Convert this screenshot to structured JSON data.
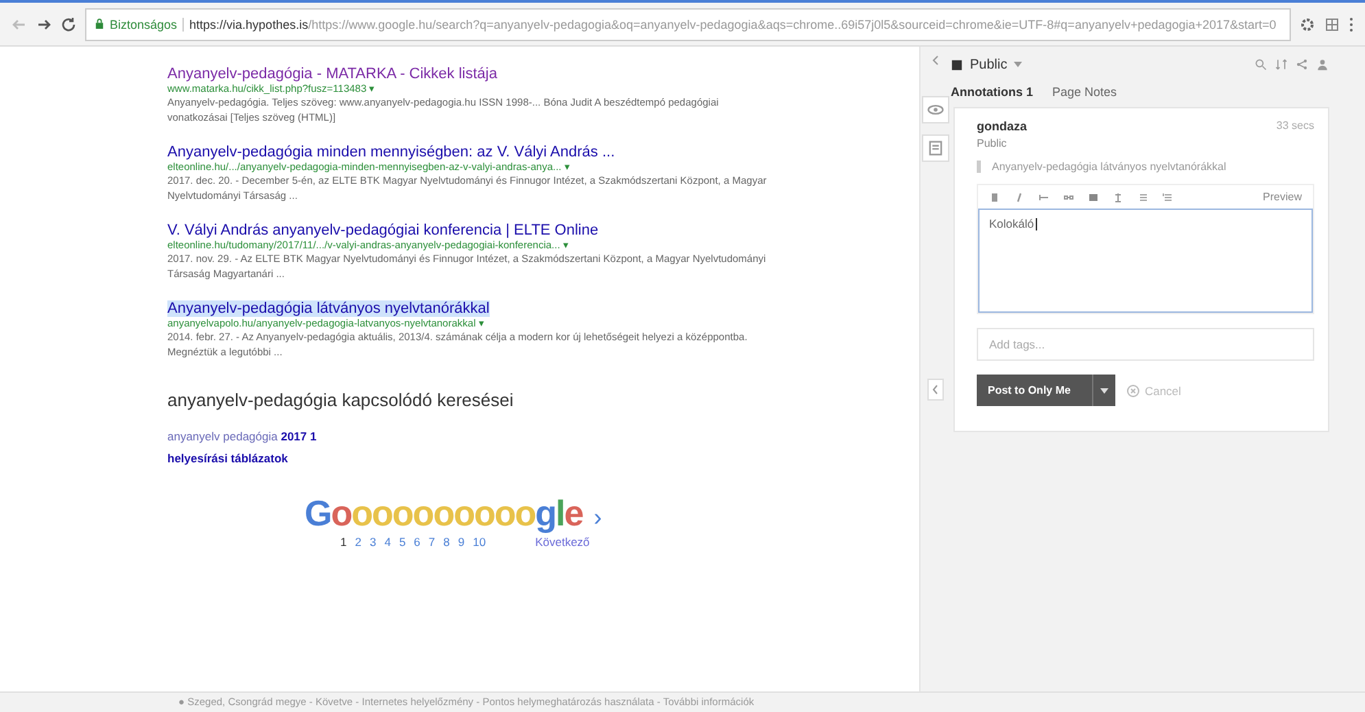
{
  "browser": {
    "secure_label": "Biztonságos",
    "url_host": "https://via.hypothes.is",
    "url_rest": "/https://www.google.hu/search?q=anyanyelv-pedagogia&oq=anyanyelv-pedagogia&aqs=chrome..69i57j0l5&sourceid=chrome&ie=UTF-8#q=anyanyelv+pedagogia+2017&start=0"
  },
  "results": [
    {
      "title": "Anyanyelv-pedagógia - MATARKA - Cikkek listája",
      "url": "www.matarka.hu/cikk_list.php?fusz=113483 ▾",
      "snippet": "Anyanyelv-pedagógia. Teljes szöveg: www.anyanyelv-pedagogia.hu ISSN 1998-... Bóna Judit A beszédtempó pedagógiai vonatkozásai [Teljes szöveg (HTML)]",
      "visited": true,
      "highlighted": false
    },
    {
      "title": "Anyanyelv-pedagógia minden mennyiségben: az V. Vályi András ...",
      "url": "elteonline.hu/.../anyanyelv-pedagogia-minden-mennyisegben-az-v-valyi-andras-anya... ▾",
      "snippet": "2017. dec. 20. - December 5-én, az ELTE BTK Magyar Nyelvtudományi és Finnugor Intézet, a Szakmódszertani Központ, a Magyar Nyelvtudományi Társaság ...",
      "visited": false,
      "highlighted": false
    },
    {
      "title": "V. Vályi András anyanyelv-pedagógiai konferencia | ELTE Online",
      "url": "elteonline.hu/tudomany/2017/11/.../v-valyi-andras-anyanyelv-pedagogiai-konferencia... ▾",
      "snippet": "2017. nov. 29. - Az ELTE BTK Magyar Nyelvtudományi és Finnugor Intézet, a Szakmódszertani Központ, a Magyar Nyelvtudományi Társaság Magyartanári ...",
      "visited": false,
      "highlighted": false
    },
    {
      "title": "Anyanyelv-pedagógia látványos nyelvtanórákkal",
      "url": "anyanyelvapolo.hu/anyanyelv-pedagogia-latvanyos-nyelvtanorakkal ▾",
      "snippet": "2014. febr. 27. - Az Anyanyelv-pedagógia aktuális, 2013/4. számának célja a modern kor új lehetőségeit helyezi a középpontba. Megnéztük a legutóbbi ...",
      "visited": false,
      "highlighted": true
    }
  ],
  "related": {
    "heading": "anyanyelv-pedagógia kapcsolódó keresései",
    "items": [
      {
        "plain": "anyanyelv pedagógia ",
        "bold": "2017 1"
      },
      {
        "bold": "helyesírási táblázatok"
      }
    ]
  },
  "pager": {
    "logo": "Goooooooooogle",
    "next_arrow": "›",
    "pages": [
      {
        "label": "1",
        "selected": true
      },
      {
        "label": "2",
        "selected": false
      },
      {
        "label": "3",
        "selected": false
      },
      {
        "label": "4",
        "selected": false
      },
      {
        "label": "5",
        "selected": false
      },
      {
        "label": "6",
        "selected": false
      },
      {
        "label": "7",
        "selected": false
      },
      {
        "label": "8",
        "selected": false
      },
      {
        "label": "9",
        "selected": false
      },
      {
        "label": "10",
        "selected": false
      }
    ],
    "next_label": "Következő"
  },
  "footer": "● Szeged, Csongrád megye - Követve - Internetes helyelőzmény - Pontos helymeghatározás használata - További információk",
  "sidebar": {
    "group": "Public",
    "tabs": [
      {
        "label": "Annotations 1",
        "selected": true
      },
      {
        "label": "Page Notes",
        "selected": false
      }
    ],
    "annotation": {
      "user": "gondaza",
      "time": "33 secs",
      "visibility": "Public",
      "quote": "Anyanyelv-pedagógia látványos nyelvtanórákkal",
      "preview_label": "Preview",
      "text": "Kolokáló",
      "tags_placeholder": "Add tags...",
      "post_label": "Post to Only Me",
      "cancel_label": "Cancel"
    }
  }
}
